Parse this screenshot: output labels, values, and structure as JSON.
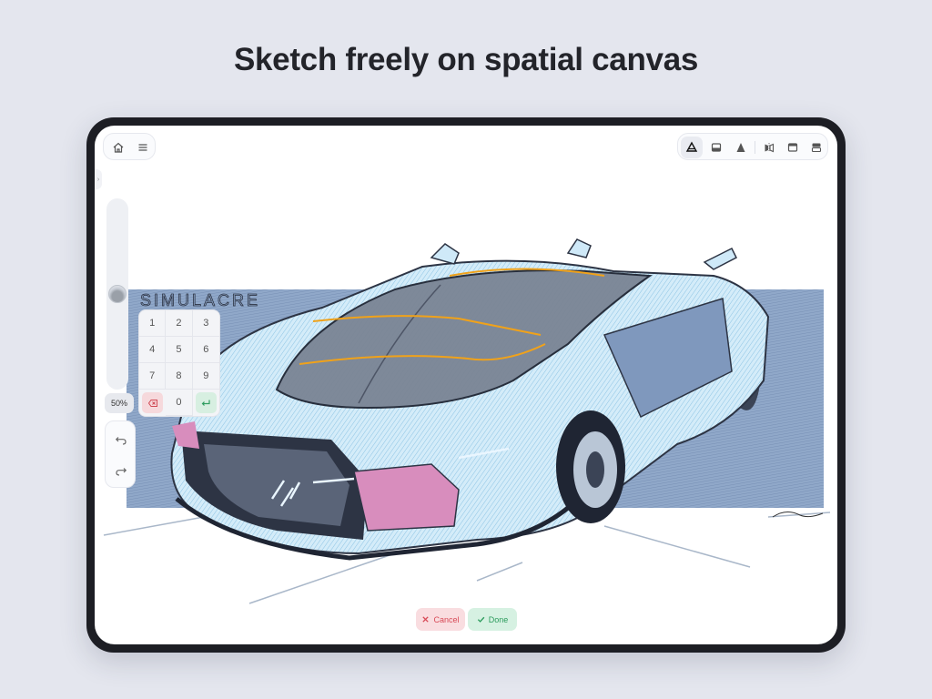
{
  "headline": "Sketch freely on spatial canvas",
  "top_left_toolbar": {
    "icons": [
      "home-icon",
      "menu-icon"
    ]
  },
  "top_right_toolbar": {
    "icons": [
      "perspective-view-icon",
      "bottom-panel-icon",
      "pen-tool-icon",
      "mirror-icon",
      "window-icon",
      "split-view-icon"
    ],
    "active": "perspective-view-icon"
  },
  "left_panel": {
    "brush_size_level": 0.5,
    "zoom_label": "50%"
  },
  "keypad": {
    "keys": [
      "1",
      "2",
      "3",
      "4",
      "5",
      "6",
      "7",
      "8",
      "9",
      "",
      "0",
      ""
    ],
    "delete_icon": "backspace-icon",
    "enter_icon": "enter-icon"
  },
  "history": {
    "undo_icon": "undo-icon",
    "redo_icon": "redo-icon"
  },
  "actions": {
    "cancel_label": "Cancel",
    "done_label": "Done"
  },
  "canvas": {
    "backdrop_text": "SIMULACRE",
    "colors": {
      "body_light": "#cfe9f8",
      "body_mid": "#9fc3df",
      "panel_blue": "#7f98bd",
      "glass": "#7a8494",
      "accent_orange": "#f0a21a",
      "headlight_pink": "#d88dbd",
      "dark": "#2d3444"
    }
  }
}
